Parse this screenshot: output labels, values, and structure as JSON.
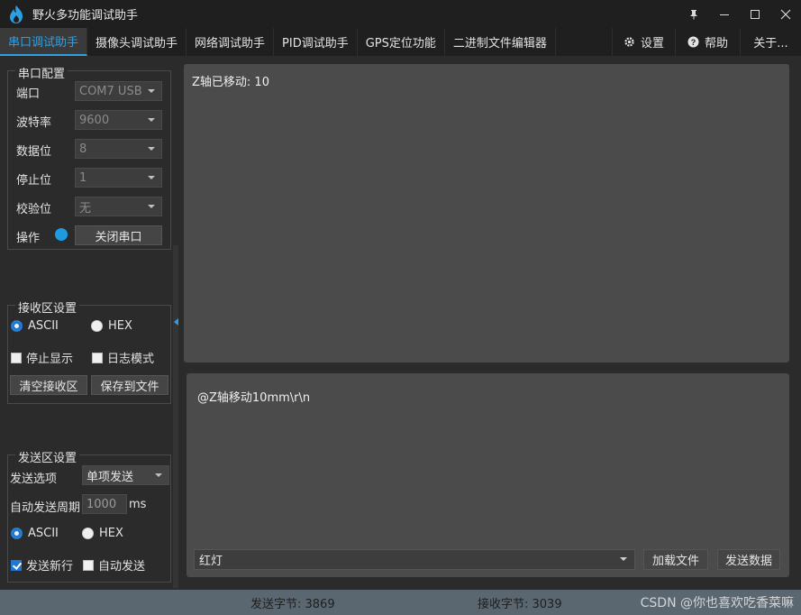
{
  "window": {
    "title": "野火多功能调试助手",
    "controls": [
      "pin-icon",
      "minimize-icon",
      "maximize-icon",
      "close-icon"
    ]
  },
  "tabs": {
    "left": [
      {
        "label": "串口调试助手",
        "active": true
      },
      {
        "label": "摄像头调试助手"
      },
      {
        "label": "网络调试助手"
      },
      {
        "label": "PID调试助手"
      },
      {
        "label": "GPS定位功能"
      },
      {
        "label": "二进制文件编辑器"
      }
    ],
    "right": [
      {
        "label": "设置",
        "icon": "gear-icon"
      },
      {
        "label": "帮助",
        "icon": "help-icon"
      },
      {
        "label": "关于..."
      }
    ]
  },
  "serial_config": {
    "title": "串口配置",
    "port": {
      "label": "端口",
      "value": "COM7 USB"
    },
    "baud": {
      "label": "波特率",
      "value": "9600"
    },
    "databits": {
      "label": "数据位",
      "value": "8"
    },
    "stopbits": {
      "label": "停止位",
      "value": "1"
    },
    "parity": {
      "label": "校验位",
      "value": "无"
    },
    "operate": {
      "label": "操作",
      "button": "关闭串口",
      "status_color": "#1e9be0"
    }
  },
  "recv_settings": {
    "title": "接收区设置",
    "ascii": "ASCII",
    "hex": "HEX",
    "stop_display": "停止显示",
    "log_mode": "日志模式",
    "clear_btn": "清空接收区",
    "save_btn": "保存到文件"
  },
  "send_settings": {
    "title": "发送区设置",
    "option_label": "发送选项",
    "option_value": "单项发送",
    "period_label": "自动发送周期",
    "period_value": "1000",
    "period_unit": "ms",
    "ascii": "ASCII",
    "hex": "HEX",
    "newline": "发送新行",
    "auto_send": "自动发送"
  },
  "receive_area": {
    "text": "Z轴已移动: 10"
  },
  "send_area": {
    "text": "@Z轴移动10mm\\r\\n",
    "preset_value": "红灯",
    "load_btn": "加载文件",
    "send_btn": "发送数据"
  },
  "status": {
    "sent": "发送字节: 3869",
    "received": "接收字节: 3039"
  },
  "watermark": "CSDN @你也喜欢吃香菜嘛",
  "colors": {
    "accent": "#2f9fe3",
    "status_bar": "#5b6770"
  }
}
